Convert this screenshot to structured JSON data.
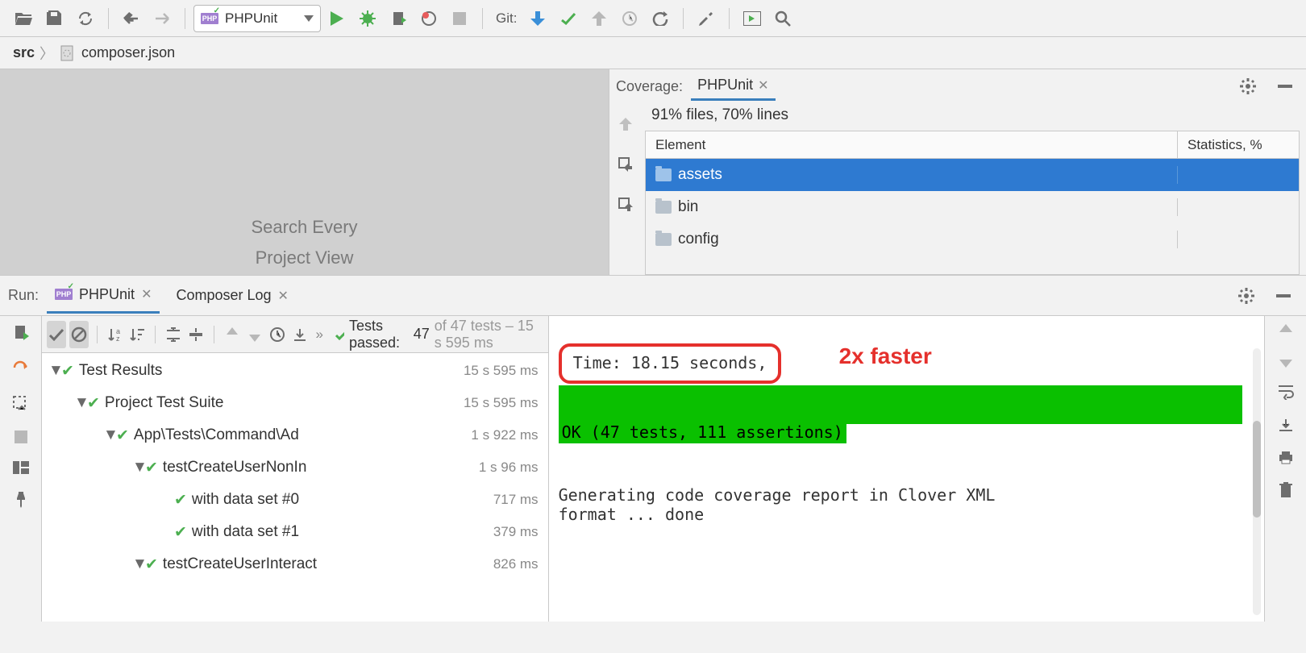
{
  "toolbar": {
    "run_config_label": "PHPUnit",
    "git_label": "Git:"
  },
  "breadcrumb": {
    "root": "src",
    "file": "composer.json"
  },
  "editor_hints": {
    "line1": "Search Every",
    "line2": "Project View"
  },
  "coverage": {
    "title": "Coverage:",
    "tab": "PHPUnit",
    "summary": "91% files, 70% lines",
    "columns": {
      "element": "Element",
      "stats": "Statistics, %"
    },
    "rows": [
      {
        "name": "assets",
        "stats": "",
        "selected": true
      },
      {
        "name": "bin",
        "stats": ""
      },
      {
        "name": "config",
        "stats": ""
      }
    ]
  },
  "run": {
    "label": "Run:",
    "tabs": [
      {
        "label": "PHPUnit",
        "active": true
      },
      {
        "label": "Composer Log",
        "active": false
      }
    ]
  },
  "results": {
    "status_prefix": "Tests passed:",
    "status_count": "47",
    "status_suffix": "of 47 tests – 15 s 595 ms",
    "tree": [
      {
        "indent": 0,
        "name": "Test Results",
        "time": "15 s 595 ms",
        "chev": true
      },
      {
        "indent": 1,
        "name": "Project Test Suite",
        "time": "15 s 595 ms",
        "chev": true
      },
      {
        "indent": 2,
        "name": "App\\Tests\\Command\\Ad",
        "time": "1 s 922 ms",
        "chev": true
      },
      {
        "indent": 3,
        "name": "testCreateUserNonIn",
        "time": "1 s 96 ms",
        "chev": true
      },
      {
        "indent": 4,
        "name": "with data set #0",
        "time": "717 ms",
        "chev": false
      },
      {
        "indent": 4,
        "name": "with data set #1",
        "time": "379 ms",
        "chev": false
      },
      {
        "indent": 3,
        "name": "testCreateUserInteract",
        "time": "826 ms",
        "chev": true
      }
    ]
  },
  "console": {
    "time_line": "Time: 18.15 seconds,",
    "annotation": "2x faster",
    "ok_line": "OK (47 tests, 111 assertions)",
    "gen_line1": "Generating code coverage report in Clover XML",
    "gen_line2": " format ... done"
  }
}
